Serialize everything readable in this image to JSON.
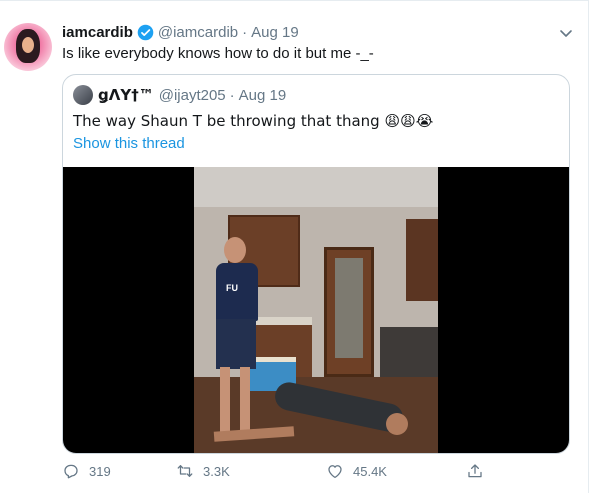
{
  "tweet": {
    "display_name": "iamcardib",
    "verified": true,
    "handle": "@iamcardib",
    "separator": "·",
    "date": "Aug 19",
    "text": "Is like everybody knows how to do it but me -_-"
  },
  "quoted": {
    "display_name": "ǥΛY†™",
    "handle": "@ijayt205",
    "separator": "·",
    "date": "Aug 19",
    "text": "The way Shaun T be throwing that thang 😩😩😭",
    "show_thread": "Show this thread",
    "media": {
      "shirt_logo": "FU"
    }
  },
  "actions": {
    "reply_count": "319",
    "retweet_count": "3.3K",
    "like_count": "45.4K"
  },
  "colors": {
    "accent": "#1b95e0",
    "verified": "#1da1f2",
    "muted": "#657786"
  },
  "icons": [
    "verified-badge-icon",
    "chevron-down-icon",
    "reply-icon",
    "retweet-icon",
    "like-icon",
    "share-icon"
  ]
}
